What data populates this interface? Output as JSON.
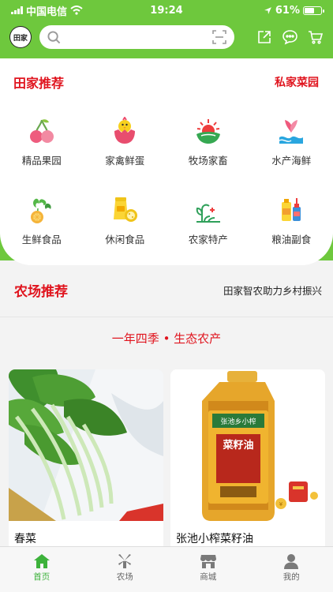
{
  "status": {
    "carrier": "中国电信",
    "time": "19:24",
    "battery": "61%",
    "battery_level": 0.61
  },
  "search": {
    "logo_text": "田家",
    "placeholder": ""
  },
  "header_icons": [
    "share-icon",
    "chat-icon",
    "cart-icon"
  ],
  "recommend": {
    "title": "田家推荐",
    "link": "私家菜园",
    "categories": [
      {
        "label": "精品果园",
        "icon": "cherry-icon"
      },
      {
        "label": "家禽鲜蛋",
        "icon": "egg-chick-icon"
      },
      {
        "label": "牧场家畜",
        "icon": "sun-farm-icon"
      },
      {
        "label": "水产海鲜",
        "icon": "fish-icon"
      },
      {
        "label": "生鲜食品",
        "icon": "vegetable-icon"
      },
      {
        "label": "休闲食品",
        "icon": "snack-icon"
      },
      {
        "label": "农家特产",
        "icon": "farm-plant-icon"
      },
      {
        "label": "粮油副食",
        "icon": "oil-bottle-icon"
      }
    ]
  },
  "farm": {
    "title": "农场推荐",
    "subtitle": "田家智农助力乡村振兴",
    "slogan": "一年四季 • 生态农产"
  },
  "products": [
    {
      "name": "春菜"
    },
    {
      "name": "张池小榨菜籽油",
      "label_big": "菜籽油",
      "label_small": "张池乡小榨"
    }
  ],
  "tabs": [
    {
      "label": "首页",
      "icon": "home-icon",
      "active": true
    },
    {
      "label": "农场",
      "icon": "windmill-icon",
      "active": false
    },
    {
      "label": "商城",
      "icon": "store-icon",
      "active": false
    },
    {
      "label": "我的",
      "icon": "user-icon",
      "active": false
    }
  ],
  "colors": {
    "brand": "#6ec83d",
    "accent": "#e0141e",
    "tab_active": "#3db23b"
  }
}
